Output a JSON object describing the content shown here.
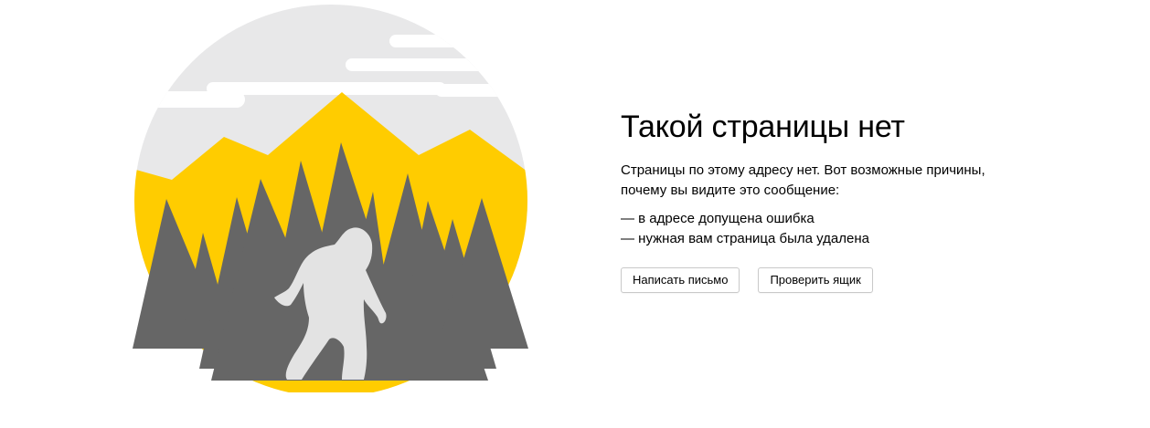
{
  "error": {
    "title": "Такой страницы нет",
    "lead": "Страницы по этому адресу нет. Вот возможные причины, почему вы видите это сообщение:",
    "reasons": [
      "— в адресе допущена ошибка",
      "— нужная вам страница была удалена"
    ]
  },
  "actions": {
    "write_letter": "Написать письмо",
    "check_inbox": "Проверить ящик"
  },
  "colors": {
    "sky": "#e8e8e9",
    "mountains": "#ffcc00",
    "trees": "#666666",
    "yeti": "#e3e3e3"
  },
  "illustration": {
    "icon": "yeti-forest-illustration"
  }
}
